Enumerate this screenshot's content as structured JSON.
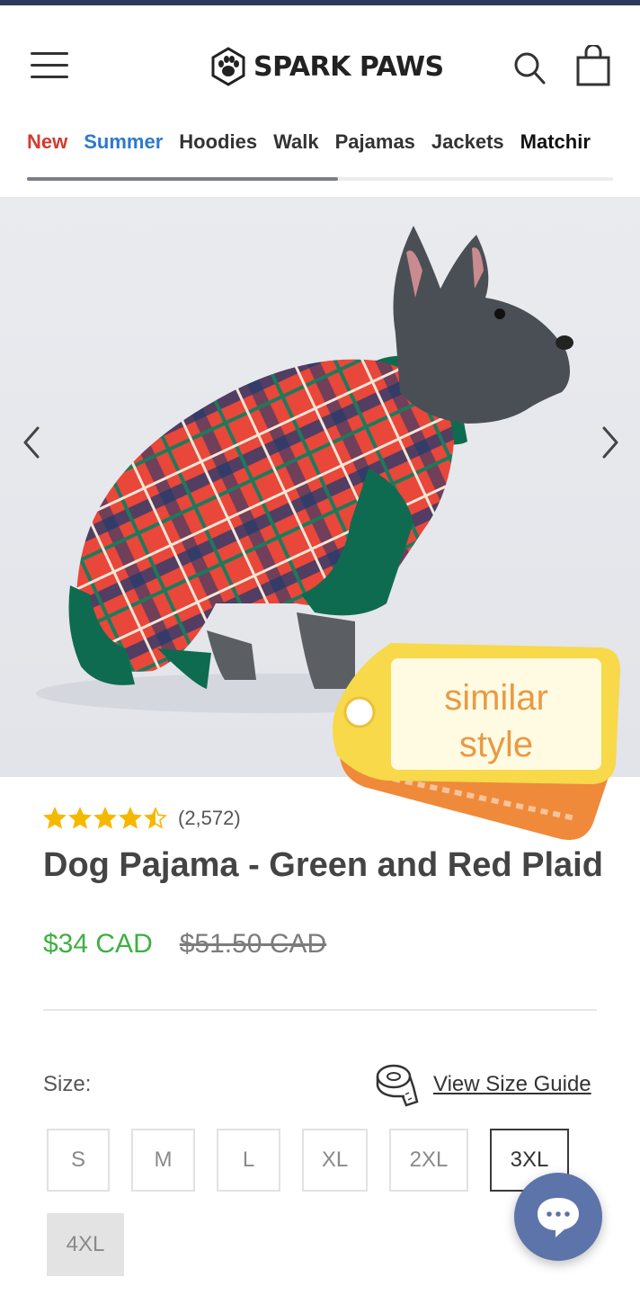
{
  "brand": {
    "name": "SPARK PAWS",
    "accent_color": "#2b3a5c"
  },
  "header": {
    "menu_icon": "hamburger-menu-icon",
    "search_icon": "search-icon",
    "cart_icon": "shopping-bag-icon"
  },
  "categories": {
    "items": [
      "New",
      "Summer",
      "Hoodies",
      "Walk",
      "Pajamas",
      "Jackets",
      "Matchir"
    ],
    "scroll_progress": 0.53
  },
  "gallery": {
    "prev_icon": "chevron-left-icon",
    "next_icon": "chevron-right-icon"
  },
  "badge": {
    "line1": "similar",
    "line2": "style"
  },
  "product": {
    "rating_value": 4.5,
    "rating_max": 5,
    "review_count": "(2,572)",
    "title": "Dog Pajama - Green and Red Plaid",
    "sale_price": "$34 CAD",
    "original_price": "$51.50 CAD",
    "sale_color": "#3db043"
  },
  "size": {
    "label": "Size:",
    "guide_icon": "measuring-tape-icon",
    "guide_label": "View Size Guide",
    "options": [
      "S",
      "M",
      "L",
      "XL",
      "2XL",
      "3XL",
      "4XL"
    ],
    "selected": "3XL",
    "unavailable": "4XL"
  },
  "chat": {
    "icon": "chat-bubble-icon",
    "color": "#5c74a9"
  }
}
